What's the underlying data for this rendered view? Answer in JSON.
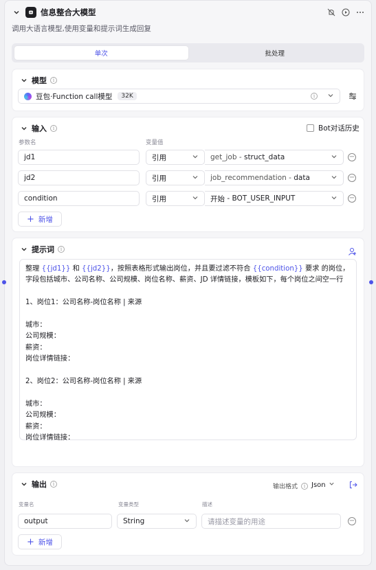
{
  "header": {
    "title": "信息整合大模型",
    "description": "调用大语言模型,使用变量和提示词生成回复"
  },
  "tabs": [
    {
      "label": "单次",
      "active": true
    },
    {
      "label": "批处理",
      "active": false
    }
  ],
  "model": {
    "section_title": "模型",
    "name": "豆包·Function call模型",
    "context": "32K"
  },
  "input": {
    "section_title": "输入",
    "bot_history_label": "Bot对话历史",
    "col_param": "参数名",
    "col_value": "变量值",
    "rows": [
      {
        "name": "jd1",
        "type": "引用",
        "source": "get_job",
        "field": "struct_data"
      },
      {
        "name": "jd2",
        "type": "引用",
        "source": "job_recommendation",
        "field": "data"
      },
      {
        "name": "condition",
        "type": "引用",
        "source": "开始",
        "field": "BOT_USER_INPUT"
      }
    ],
    "add_label": "新增"
  },
  "prompt": {
    "section_title": "提示词",
    "line1_a": "整理 ",
    "var1": "{{jd1}}",
    "line1_b": " 和 ",
    "var2": "{{jd2}}",
    "line1_c": "，按照表格形式输出岗位，并且要过滤不符合 ",
    "var3": "{{condition}}",
    "line1_d": " 要求 的岗位，字段包括城市、公司名称、公司规模、岗位名称、薪资、JD 详情链接，模板如下，每个岗位之间空一行",
    "body": "\n\n1、岗位1：公司名称-岗位名称 | 来源\n\n城市：\n公司规模：\n薪资：\n岗位详情链接：\n\n2、岗位2：公司名称-岗位名称 | 来源\n\n城市：\n公司规模：\n薪资：\n岗位详情链接："
  },
  "output": {
    "section_title": "输出",
    "format_label": "输出格式",
    "format_value": "Json",
    "col_name": "变量名",
    "col_type": "变量类型",
    "col_desc": "描述",
    "rows": [
      {
        "name": "output",
        "type": "String",
        "desc_placeholder": "请描述变量的用途"
      }
    ],
    "add_label": "新增"
  },
  "colors": {
    "accent": "#4d53e8",
    "background": "#f6f6f8"
  }
}
